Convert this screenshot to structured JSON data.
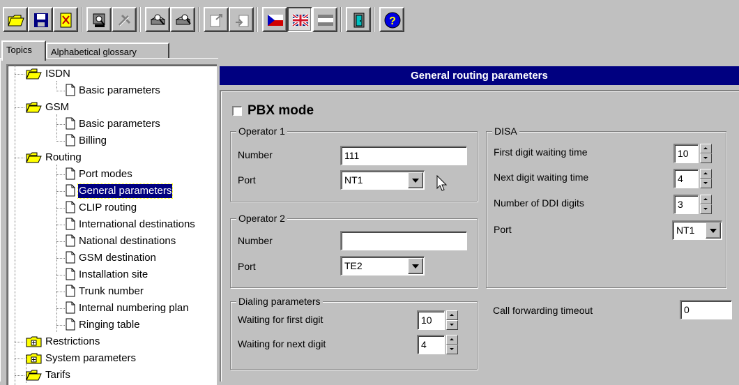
{
  "toolbar": {
    "buttons": [
      {
        "icon": "open-folder-icon"
      },
      {
        "icon": "save-icon"
      },
      {
        "icon": "delete-file-icon"
      },
      {
        "icon": "find-icon"
      },
      {
        "icon": "tools-disabled-icon"
      },
      {
        "icon": "device-search-icon"
      },
      {
        "icon": "device-search-2-icon"
      },
      {
        "icon": "export-icon"
      },
      {
        "icon": "import-icon"
      },
      {
        "icon": "czech-flag-icon"
      },
      {
        "icon": "uk-flag-icon"
      },
      {
        "icon": "other-flag-icon"
      },
      {
        "icon": "exit-door-icon"
      },
      {
        "icon": "help-icon"
      }
    ]
  },
  "tabs": [
    {
      "label": "Topics",
      "active": true
    },
    {
      "label": "Alphabetical glossary",
      "active": false
    }
  ],
  "tree": {
    "items": [
      {
        "label": "ISDN",
        "type": "folder-open",
        "level": 0
      },
      {
        "label": "Basic parameters",
        "type": "page",
        "level": 1
      },
      {
        "label": "GSM",
        "type": "folder-open",
        "level": 0
      },
      {
        "label": "Basic parameters",
        "type": "page",
        "level": 1
      },
      {
        "label": "Billing",
        "type": "page",
        "level": 1
      },
      {
        "label": "Routing",
        "type": "folder-open",
        "level": 0
      },
      {
        "label": "Port modes",
        "type": "page",
        "level": 1
      },
      {
        "label": "General parameters",
        "type": "page",
        "level": 1,
        "selected": true
      },
      {
        "label": "CLIP routing",
        "type": "page",
        "level": 1
      },
      {
        "label": "International destinations",
        "type": "page",
        "level": 1
      },
      {
        "label": "National destinations",
        "type": "page",
        "level": 1
      },
      {
        "label": "GSM destination",
        "type": "page",
        "level": 1
      },
      {
        "label": "Installation site",
        "type": "page",
        "level": 1
      },
      {
        "label": "Trunk number",
        "type": "page",
        "level": 1
      },
      {
        "label": "Internal numbering plan",
        "type": "page",
        "level": 1
      },
      {
        "label": "Ringing table",
        "type": "page",
        "level": 1
      },
      {
        "label": "Restrictions",
        "type": "folder-closed",
        "level": 0
      },
      {
        "label": "System parameters",
        "type": "folder-closed",
        "level": 0
      },
      {
        "label": "Tarifs",
        "type": "folder-open",
        "level": 0
      }
    ]
  },
  "main": {
    "title": "General routing parameters",
    "pbx_mode": {
      "label": "PBX mode",
      "checked": false
    },
    "operator1": {
      "legend": "Operator 1",
      "number_label": "Number",
      "number_value": "111",
      "port_label": "Port",
      "port_value": "NT1"
    },
    "operator2": {
      "legend": "Operator 2",
      "number_label": "Number",
      "number_value": "",
      "port_label": "Port",
      "port_value": "TE2"
    },
    "dialing": {
      "legend": "Dialing parameters",
      "first_label": "Waiting for first digit",
      "first_value": "10",
      "next_label": "Waiting for next digit",
      "next_value": "4"
    },
    "disa": {
      "legend": "DISA",
      "first_label": "First digit waiting time",
      "first_value": "10",
      "next_label": "Next digit waiting time",
      "next_value": "4",
      "ddi_label": "Number of DDI digits",
      "ddi_value": "3",
      "port_label": "Port",
      "port_value": "NT1"
    },
    "call_forwarding": {
      "label": "Call forwarding timeout",
      "value": "0"
    }
  },
  "colors": {
    "face": "#c0c0c0",
    "title_bar": "#000080",
    "selection": "#000080"
  }
}
